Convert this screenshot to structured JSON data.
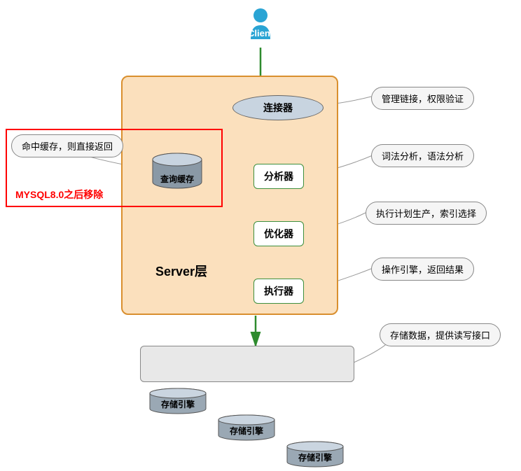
{
  "client": {
    "label": "Client"
  },
  "server": {
    "layer_label": "Server层",
    "connector": {
      "label": "连接器",
      "desc": "管理链接，权限验证"
    },
    "cache": {
      "label": "查询缓存",
      "desc": "命中缓存，则直接返回",
      "removed_note": "MYSQL8.0之后移除"
    },
    "analyzer": {
      "label": "分析器",
      "desc": "词法分析，语法分析"
    },
    "optimizer": {
      "label": "优化器",
      "desc": "执行计划生产，索引选择"
    },
    "executor": {
      "label": "执行器",
      "desc": "操作引擎，返回结果"
    }
  },
  "storage": {
    "engines": [
      "存储引擎",
      "存储引擎",
      "存储引擎"
    ],
    "desc": "存储数据，提供读写接口"
  }
}
